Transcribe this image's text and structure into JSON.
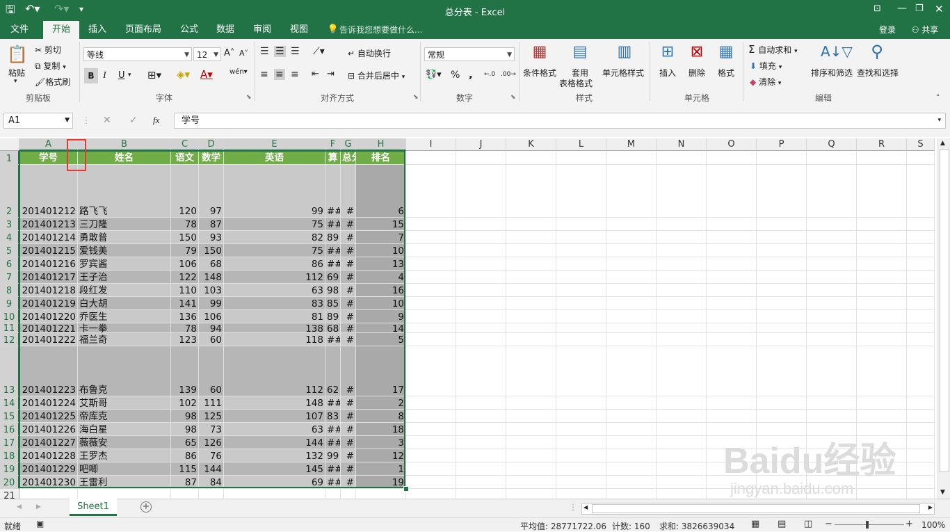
{
  "window": {
    "title": "总分表 - Excel",
    "login": "登录",
    "share": "共享"
  },
  "tabs": [
    "文件",
    "开始",
    "插入",
    "页面布局",
    "公式",
    "数据",
    "审阅",
    "视图"
  ],
  "tellme": "告诉我您想要做什么...",
  "ribbon": {
    "clipboard": {
      "paste": "粘贴",
      "cut": "剪切",
      "copy": "复制",
      "format_painter": "格式刷",
      "group": "剪贴板"
    },
    "font": {
      "name": "等线",
      "size": "12",
      "bold": "B",
      "italic": "I",
      "underline": "U",
      "group": "字体"
    },
    "align": {
      "wrap": "自动换行",
      "merge": "合并后居中",
      "group": "对齐方式"
    },
    "number": {
      "format": "常规",
      "percent": "%",
      "comma": ",",
      "group": "数字"
    },
    "styles": {
      "cond": "条件格式",
      "table": "套用",
      "table2": "表格格式",
      "cell": "单元格样式",
      "group": "样式"
    },
    "cells": {
      "insert": "插入",
      "delete": "删除",
      "format": "格式",
      "group": "单元格"
    },
    "edit": {
      "autosum": "自动求和",
      "fill": "填充",
      "clear": "清除",
      "sort": "排序和筛选",
      "find": "查找和选择",
      "group": "编辑"
    }
  },
  "formula": {
    "namebox": "A1",
    "fx": "fx",
    "content": "学号"
  },
  "columns": [
    "A",
    "B",
    "C",
    "D",
    "E",
    "F",
    "G",
    "H",
    "I",
    "J",
    "K",
    "L",
    "M",
    "N",
    "O",
    "P",
    "Q",
    "R",
    "S"
  ],
  "header_row": [
    "学号",
    "姓名",
    "语文",
    "数学",
    "英语",
    "算",
    "总分",
    "排名"
  ],
  "rows": [
    {
      "n": "2",
      "id": "201401212",
      "name": "路飞飞",
      "c": "120",
      "d": "97",
      "e": "99",
      "f": "##",
      "g": "#",
      "h": "6"
    },
    {
      "n": "3",
      "id": "201401213",
      "name": "三刀隆",
      "c": "78",
      "d": "87",
      "e": "75",
      "f": "##",
      "g": "#",
      "h": "15"
    },
    {
      "n": "4",
      "id": "201401214",
      "name": "勇敢普",
      "c": "150",
      "d": "93",
      "e": "82",
      "f": "89",
      "g": "#",
      "h": "7"
    },
    {
      "n": "5",
      "id": "201401215",
      "name": "爱钱美",
      "c": "79",
      "d": "150",
      "e": "75",
      "f": "##",
      "g": "#",
      "h": "10"
    },
    {
      "n": "6",
      "id": "201401216",
      "name": "罗宾酱",
      "c": "106",
      "d": "68",
      "e": "86",
      "f": "##",
      "g": "#",
      "h": "13"
    },
    {
      "n": "7",
      "id": "201401217",
      "name": "王子治",
      "c": "122",
      "d": "148",
      "e": "112",
      "f": "69",
      "g": "#",
      "h": "4"
    },
    {
      "n": "8",
      "id": "201401218",
      "name": "段红发",
      "c": "110",
      "d": "103",
      "e": "63",
      "f": "98",
      "g": "#",
      "h": "16"
    },
    {
      "n": "9",
      "id": "201401219",
      "name": "白大胡",
      "c": "141",
      "d": "99",
      "e": "83",
      "f": "85",
      "g": "#",
      "h": "10"
    },
    {
      "n": "10",
      "id": "201401220",
      "name": "乔医生",
      "c": "136",
      "d": "106",
      "e": "81",
      "f": "89",
      "g": "#",
      "h": "9"
    },
    {
      "n": "11",
      "id": "201401221",
      "name": "卡一拳",
      "c": "78",
      "d": "94",
      "e": "138",
      "f": "68",
      "g": "#",
      "h": "14"
    },
    {
      "n": "12",
      "id": "201401222",
      "name": "福兰奇",
      "c": "123",
      "d": "60",
      "e": "118",
      "f": "##",
      "g": "#",
      "h": "5"
    },
    {
      "n": "13",
      "id": "201401223",
      "name": "布鲁克",
      "c": "139",
      "d": "60",
      "e": "112",
      "f": "62",
      "g": "#",
      "h": "17"
    },
    {
      "n": "14",
      "id": "201401224",
      "name": "艾斯哥",
      "c": "102",
      "d": "111",
      "e": "148",
      "f": "##",
      "g": "#",
      "h": "2"
    },
    {
      "n": "15",
      "id": "201401225",
      "name": "帝库克",
      "c": "98",
      "d": "125",
      "e": "107",
      "f": "83",
      "g": "#",
      "h": "8"
    },
    {
      "n": "16",
      "id": "201401226",
      "name": "海白星",
      "c": "98",
      "d": "73",
      "e": "63",
      "f": "##",
      "g": "#",
      "h": "18"
    },
    {
      "n": "17",
      "id": "201401227",
      "name": "薇薇安",
      "c": "65",
      "d": "126",
      "e": "144",
      "f": "##",
      "g": "#",
      "h": "3"
    },
    {
      "n": "18",
      "id": "201401228",
      "name": "王罗杰",
      "c": "86",
      "d": "76",
      "e": "132",
      "f": "99",
      "g": "#",
      "h": "12"
    },
    {
      "n": "19",
      "id": "201401229",
      "name": "吧唧",
      "c": "115",
      "d": "144",
      "e": "145",
      "f": "##",
      "g": "#",
      "h": "1"
    },
    {
      "n": "20",
      "id": "201401230",
      "name": "王雷利",
      "c": "87",
      "d": "84",
      "e": "69",
      "f": "##",
      "g": "#",
      "h": "19"
    }
  ],
  "sheet": {
    "tab": "Sheet1",
    "add": "+"
  },
  "status": {
    "ready": "就绪",
    "average": "平均值: 28771722.06",
    "count": "计数: 160",
    "sum": "求和: 3826639034",
    "zoom": "100%"
  },
  "watermark": {
    "brand": "Baidu经验",
    "url": "jingyan.baidu.com"
  }
}
